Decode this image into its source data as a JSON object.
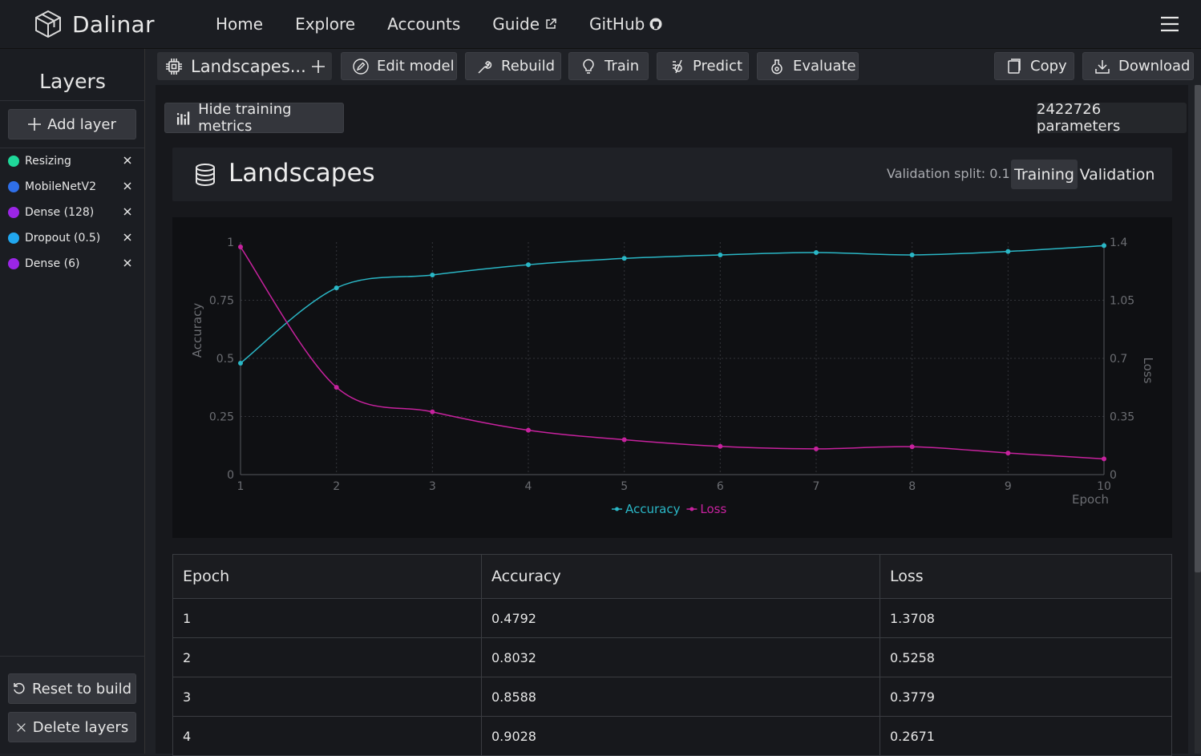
{
  "app": {
    "brand": "Dalinar"
  },
  "nav": {
    "home": "Home",
    "explore": "Explore",
    "accounts": "Accounts",
    "guide": "Guide",
    "github": "GitHub"
  },
  "sidebar": {
    "title": "Layers",
    "add_layer": "Add layer",
    "layers": [
      {
        "label": "Resizing",
        "color": "#1fd89a"
      },
      {
        "label": "MobileNetV2",
        "color": "#2f6fe8"
      },
      {
        "label": "Dense (128)",
        "color": "#9b25e6"
      },
      {
        "label": "Dropout (0.5)",
        "color": "#21a7ef"
      },
      {
        "label": "Dense (6)",
        "color": "#9b25e6"
      }
    ],
    "reset": "Reset to build",
    "delete": "Delete layers"
  },
  "toolbar": {
    "model_name": "Landscapes...",
    "edit": "Edit model",
    "rebuild": "Rebuild",
    "train": "Train",
    "predict": "Predict",
    "evaluate": "Evaluate",
    "copy": "Copy",
    "download": "Download"
  },
  "metrics": {
    "hide_button": "Hide training metrics",
    "parameters": "2422726 parameters"
  },
  "dataset": {
    "title": "Landscapes",
    "validation_split": "Validation split: 0.1",
    "tab_training": "Training",
    "tab_validation": "Validation"
  },
  "colors": {
    "accuracy": "#2ab7c6",
    "loss": "#c7229e"
  },
  "chart_data": {
    "type": "line",
    "x": [
      1,
      2,
      3,
      4,
      5,
      6,
      7,
      8,
      9,
      10
    ],
    "xlabel": "Epoch",
    "xlim": [
      1,
      10
    ],
    "x_ticks": [
      "1",
      "2",
      "3",
      "4",
      "5",
      "6",
      "7",
      "8",
      "9",
      "10"
    ],
    "left_axis": {
      "label": "Accuracy",
      "ylim": [
        0,
        1
      ],
      "ticks": [
        "0",
        "0.25",
        "0.5",
        "0.75",
        "1"
      ]
    },
    "right_axis": {
      "label": "Loss",
      "ylim": [
        0,
        1.4
      ],
      "ticks": [
        "0",
        "0.35",
        "0.7",
        "1.05",
        "1.4"
      ]
    },
    "grid": true,
    "legend": "bottom-center",
    "series": [
      {
        "name": "Accuracy",
        "axis": "left",
        "values": [
          0.4792,
          0.8032,
          0.8588,
          0.9028,
          0.93,
          0.945,
          0.955,
          0.945,
          0.96,
          0.985
        ]
      },
      {
        "name": "Loss",
        "axis": "right",
        "values": [
          1.3708,
          0.5258,
          0.3779,
          0.2671,
          0.21,
          0.17,
          0.155,
          0.168,
          0.13,
          0.095
        ]
      }
    ]
  },
  "table": {
    "headers": [
      "Epoch",
      "Accuracy",
      "Loss"
    ],
    "rows": [
      [
        "1",
        "0.4792",
        "1.3708"
      ],
      [
        "2",
        "0.8032",
        "0.5258"
      ],
      [
        "3",
        "0.8588",
        "0.3779"
      ],
      [
        "4",
        "0.9028",
        "0.2671"
      ]
    ]
  }
}
